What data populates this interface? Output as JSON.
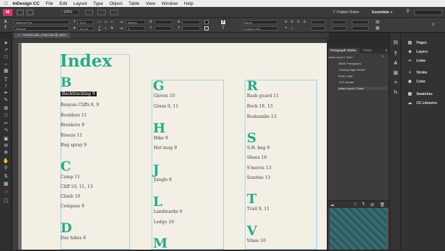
{
  "menubar": {
    "apple_icon": "apple-icon",
    "app_name": "InDesign CC",
    "items": [
      "File",
      "Edit",
      "Layout",
      "Type",
      "Object",
      "Table",
      "View",
      "Window",
      "Help"
    ]
  },
  "app_bar": {
    "zoom": "100%",
    "publish_label": "Publish Online",
    "workspace": "Essentials"
  },
  "control_panel": {
    "font_family": "Warnock Pro",
    "font_style": "Regular",
    "size": "12 pt",
    "leading": "14.4 pt",
    "kerning": "Metrics",
    "tracking": "0",
    "language": "[None]",
    "lang_value": "English: USA"
  },
  "document": {
    "tab_label": "*TravelGuide_Final.indd @ 100%"
  },
  "index_page": {
    "title": "Index",
    "columns": [
      {
        "sections": [
          {
            "letter": "B",
            "entries": [
              "Backtracking  9",
              "Banyan Cliffs  8, 9",
              "Boulders  11",
              "Breakers  9",
              "Breeze  11",
              "Bug spray  9"
            ]
          },
          {
            "letter": "C",
            "entries": [
              "Camp  11",
              "Cliff  10, 11, 13",
              "Climb  10",
              "Compass  9"
            ]
          },
          {
            "letter": "D",
            "entries": [
              "Day hikes  8"
            ]
          }
        ]
      },
      {
        "sections": [
          {
            "letter": "G",
            "entries": [
              "Gloves  10",
              "Grass  9, 11"
            ]
          },
          {
            "letter": "H",
            "entries": [
              "Hike  9",
              "Hot mug  9"
            ]
          },
          {
            "letter": "J",
            "entries": [
              "Jungle  8"
            ]
          },
          {
            "letter": "L",
            "entries": [
              "Landmarks  9",
              "Ledge  10"
            ]
          },
          {
            "letter": "M",
            "entries": []
          }
        ]
      },
      {
        "sections": [
          {
            "letter": "R",
            "entries": [
              "Rash guard  11",
              "Rock  10, 13",
              "Roshambo  13"
            ]
          },
          {
            "letter": "S",
            "entries": [
              "S.H. bag  9",
              "Shoes  10",
              "S'mores  13",
              "Sunrise  13"
            ]
          },
          {
            "letter": "T",
            "entries": [
              "Trail  9, 11"
            ]
          },
          {
            "letter": "V",
            "entries": [
              "Vines  10"
            ]
          }
        ]
      }
    ]
  },
  "paragraph_styles_panel": {
    "tabs": [
      "Paragraph Styles",
      "Chara"
    ],
    "current_style": "Index Level 1 Text+",
    "items": [
      "[Basic Paragraph]",
      "Catalog Page Header",
      "Body Large",
      "TOC Header",
      "Index Level 1 Text+"
    ],
    "selected_index": 4
  },
  "right_panel": {
    "items": [
      {
        "label": "Pages",
        "icon": "pages-icon"
      },
      {
        "label": "Layers",
        "icon": "layers-icon"
      },
      {
        "label": "Links",
        "icon": "links-icon"
      },
      {
        "label": "Stroke",
        "icon": "stroke-icon"
      },
      {
        "label": "Color",
        "icon": "color-icon"
      },
      {
        "label": "Swatches",
        "icon": "swatches-icon"
      },
      {
        "label": "CC Libraries",
        "icon": "cc-libraries-icon"
      }
    ]
  },
  "colors": {
    "index_heading": "#2aa987",
    "page_background": "#f3efe5",
    "frame_edge": "#9fd3e6",
    "ui_dark": "#3c3c3c"
  }
}
